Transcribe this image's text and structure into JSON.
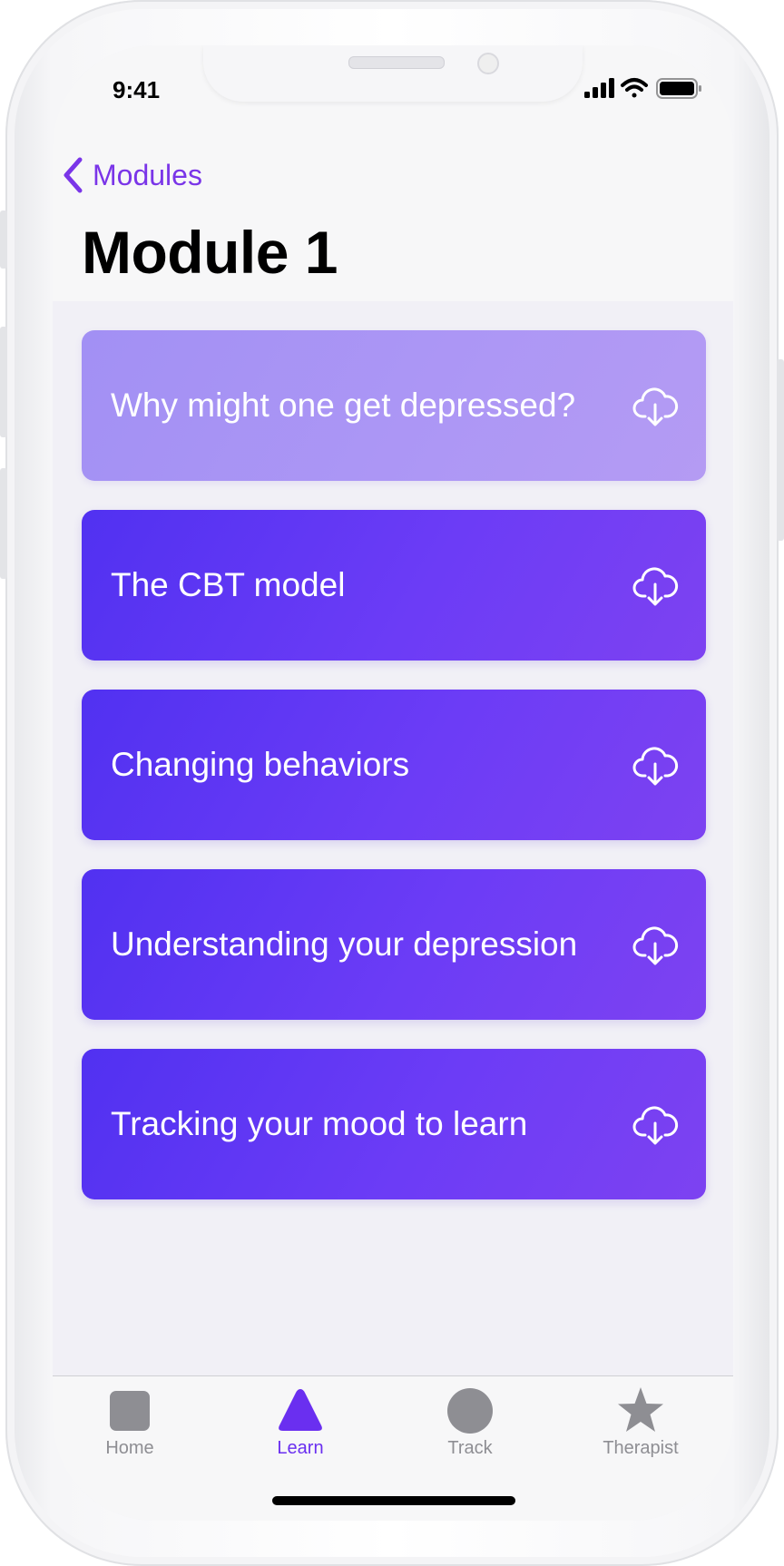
{
  "status_bar": {
    "time": "9:41"
  },
  "nav": {
    "back_label": "Modules"
  },
  "page": {
    "title": "Module 1"
  },
  "lessons": [
    {
      "title": "Why might one get depressed?",
      "state": "completed",
      "icon": "cloud-download-icon"
    },
    {
      "title": "The CBT model",
      "state": "active",
      "icon": "cloud-download-icon"
    },
    {
      "title": "Changing behaviors",
      "state": "active",
      "icon": "cloud-download-icon"
    },
    {
      "title": "Understanding your depression",
      "state": "active",
      "icon": "cloud-download-icon"
    },
    {
      "title": "Tracking your mood to learn",
      "state": "active",
      "icon": "cloud-download-icon"
    }
  ],
  "tabbar": {
    "items": [
      {
        "label": "Home",
        "icon": "square-icon"
      },
      {
        "label": "Learn",
        "icon": "triangle-icon",
        "selected": true
      },
      {
        "label": "Track",
        "icon": "circle-icon"
      },
      {
        "label": "Therapist",
        "icon": "star-icon"
      }
    ]
  },
  "colors": {
    "accent": "#6a2ff0",
    "card_gradient_start": "#5131f1",
    "card_gradient_end": "#7d42f1",
    "card_completed": "#a99af5",
    "inactive_tab": "#8e8e93"
  }
}
